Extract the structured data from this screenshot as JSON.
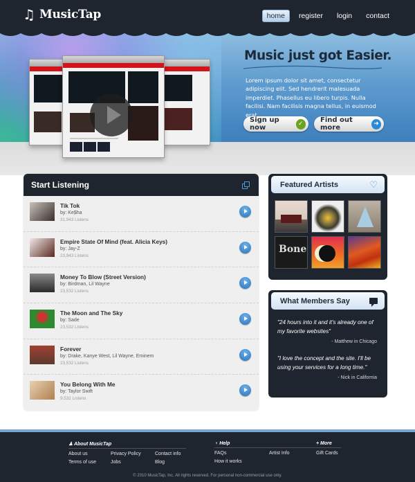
{
  "header": {
    "logo_icon": "music-note-icon",
    "logo_glyph": "♫",
    "logo_text": "MusicTap",
    "nav": [
      {
        "label": "home",
        "active": true
      },
      {
        "label": "register",
        "active": false
      },
      {
        "label": "login",
        "active": false
      },
      {
        "label": "contact",
        "active": false
      }
    ]
  },
  "hero": {
    "title": "Music just got Easier.",
    "text": "Lorem ipsum dolor sit amet, consectetur adipiscing elit. Sed hendrerit malesuada imperdiet. Phasellus eu libero turpis. Nulla facilisi. Nam facilisis magna tellus, in euismod erat.",
    "signup_label": "Sign up now",
    "signup_icon": "✓",
    "more_label": "Find out more",
    "more_icon": "➜"
  },
  "listening": {
    "title": "Start Listening",
    "tracks": [
      {
        "title": "Tik Tok",
        "by": "by: Ke$ha",
        "listens": "31,943 Listens"
      },
      {
        "title": "Empire State Of Mind (feat. Alicia Keys)",
        "by": "by: Jay-Z",
        "listens": "23,943 Listens"
      },
      {
        "title": "Money To Blow (Street Version)",
        "by": "by:  Birdman, Lil Wayne",
        "listens": "23,532 Listens"
      },
      {
        "title": "The Moon and The Sky",
        "by": "by:  Sade",
        "listens": "23,532 Listens"
      },
      {
        "title": "Forever",
        "by": "by:   Drake, Kanye West, Lil Wayne, Eminem",
        "listens": "23,532 Listens"
      },
      {
        "title": "You Belong With Me",
        "by": "by:   Taylor Swift",
        "listens": "9,532 Listens"
      }
    ]
  },
  "featured": {
    "title": "Featured Artists",
    "heart_glyph": "♡"
  },
  "members": {
    "title": "What Members Say",
    "quotes": [
      {
        "text": "\"24 hours into it and it's already one of my favorite websites\"",
        "author": "- Matthew in Chicago"
      },
      {
        "text": "\"I love the concept and the site. I'll be using your services for a long time.\"",
        "author": "- Nick in California"
      }
    ]
  },
  "footer": {
    "about": {
      "heading": "♟ About MusicTap",
      "links": [
        "About us",
        "Privacy Policy",
        "Contact info",
        "Terms of use",
        "Jobs",
        "Blog"
      ]
    },
    "help": {
      "heading": "♀ Help",
      "links": [
        "FAQs",
        "Artist Info",
        "How it works"
      ]
    },
    "more": {
      "heading": "+ More",
      "links": [
        "Gift Cards"
      ]
    },
    "copyright": "© 2010 MusicTap, Inc. All rights reserved. For personal non-commercial use only."
  }
}
